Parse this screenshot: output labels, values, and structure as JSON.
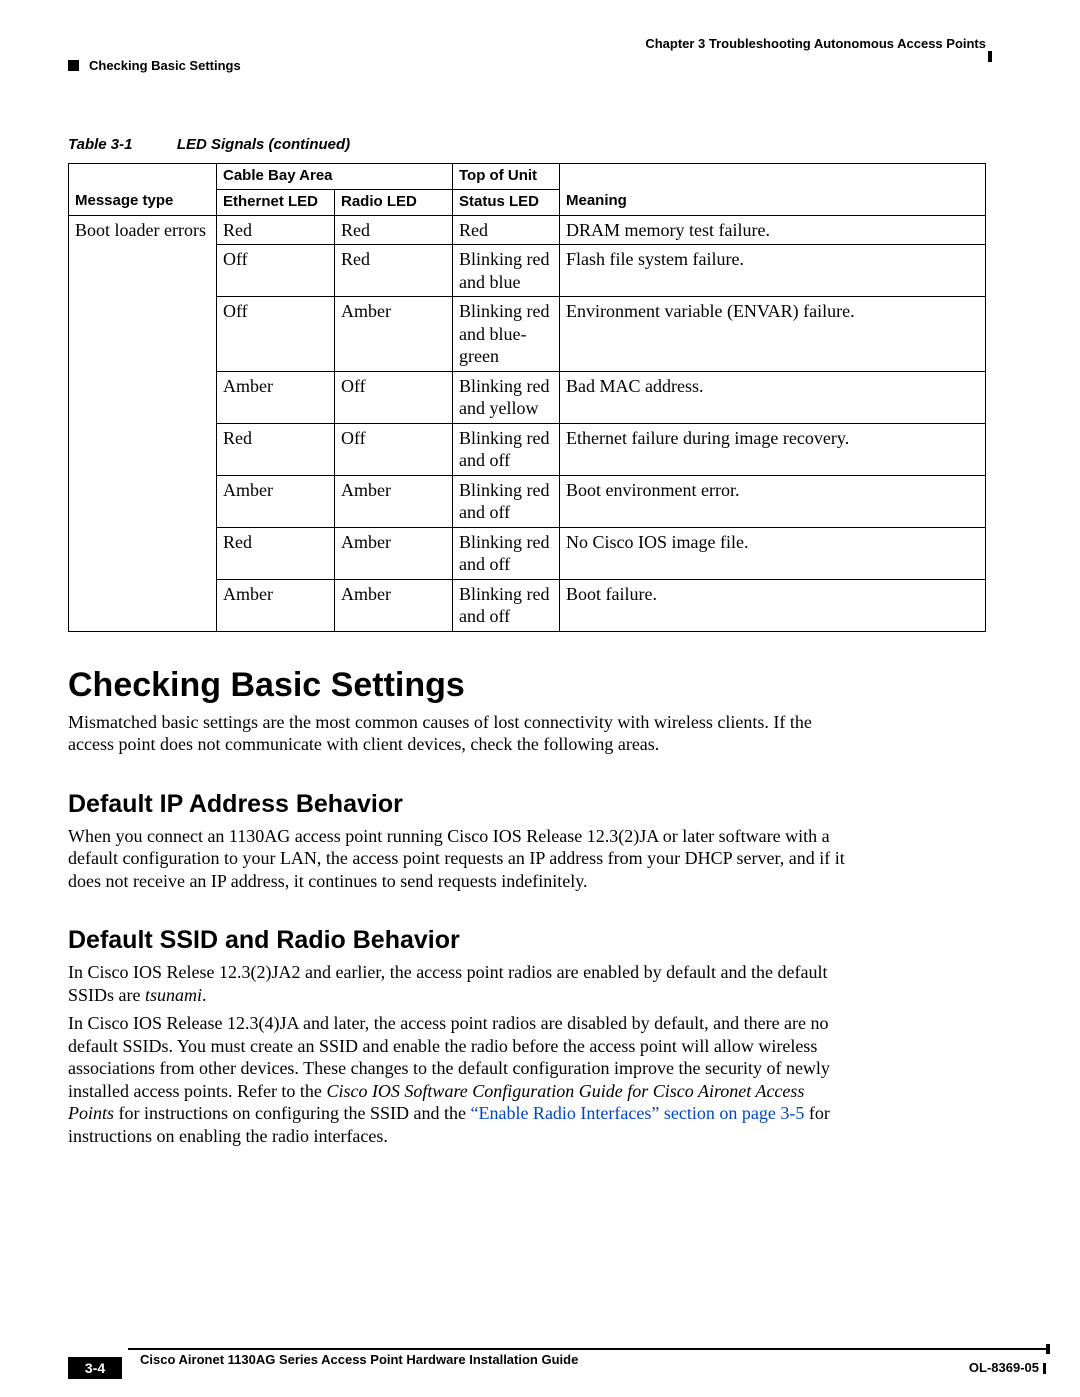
{
  "header": {
    "chapter": "Chapter 3      Troubleshooting Autonomous Access Points",
    "section": "Checking Basic Settings"
  },
  "table": {
    "caption_num": "Table 3-1",
    "caption_title": "LED Signals (continued)",
    "group1": "Cable Bay Area",
    "group2": "Top of Unit",
    "h1": "Message type",
    "h2": "Ethernet LED",
    "h3": "Radio LED",
    "h4": "Status LED",
    "h5": "Meaning",
    "r1": {
      "c1": "Boot loader errors",
      "c2": "Red",
      "c3": "Red",
      "c4": "Red",
      "c5": "DRAM memory test failure."
    },
    "r2": {
      "c2": "Off",
      "c3": "Red",
      "c4": "Blinking red and blue",
      "c5": "Flash file system failure."
    },
    "r3": {
      "c2": "Off",
      "c3": "Amber",
      "c4": "Blinking red and blue-green",
      "c5": "Environment variable (ENVAR) failure."
    },
    "r4": {
      "c2": "Amber",
      "c3": "Off",
      "c4": "Blinking red and yellow",
      "c5": "Bad MAC address."
    },
    "r5": {
      "c2": "Red",
      "c3": "Off",
      "c4": "Blinking red and off",
      "c5": "Ethernet failure during image recovery."
    },
    "r6": {
      "c2": "Amber",
      "c3": "Amber",
      "c4": "Blinking red and off",
      "c5": "Boot environment error."
    },
    "r7": {
      "c2": "Red",
      "c3": "Amber",
      "c4": "Blinking red and off",
      "c5": "No Cisco IOS image file."
    },
    "r8": {
      "c2": "Amber",
      "c3": "Amber",
      "c4": "Blinking red and off",
      "c5": "Boot failure."
    }
  },
  "sections": {
    "h1": "Checking Basic Settings",
    "p1": "Mismatched basic settings are the most common causes of lost connectivity with wireless clients. If the access point does not communicate with client devices, check the following areas.",
    "sub1": "Default IP Address Behavior",
    "p2": "When you connect an 1130AG access point running Cisco IOS Release 12.3(2)JA or later software with a default configuration to your LAN, the access point requests an IP address from your DHCP server, and if it does not receive an IP address, it continues to send requests indefinitely.",
    "sub2": "Default SSID and Radio Behavior",
    "p3a": "In Cisco IOS Relese 12.3(2)JA2 and earlier, the access point radios are enabled by default and the default SSIDs are ",
    "p3b": "tsunami",
    "p3c": ".",
    "p4a": "In Cisco IOS Release 12.3(4)JA and later, the access point radios are disabled by default, and there are no default SSIDs. You must create an SSID and enable the radio before the access point will allow wireless associations from other devices. These changes to the default configuration improve the security of newly installed access points. Refer to the ",
    "p4b": "Cisco IOS Software Configuration Guide for Cisco Aironet Access Points",
    "p4c": " for instructions on configuring the SSID and the ",
    "p4link": "“Enable Radio Interfaces” section on page 3-5",
    "p4d": " for instructions on enabling the radio interfaces."
  },
  "footer": {
    "title": "Cisco Aironet 1130AG Series Access Point Hardware Installation Guide",
    "page": "3-4",
    "docnum": "OL-8369-05"
  }
}
